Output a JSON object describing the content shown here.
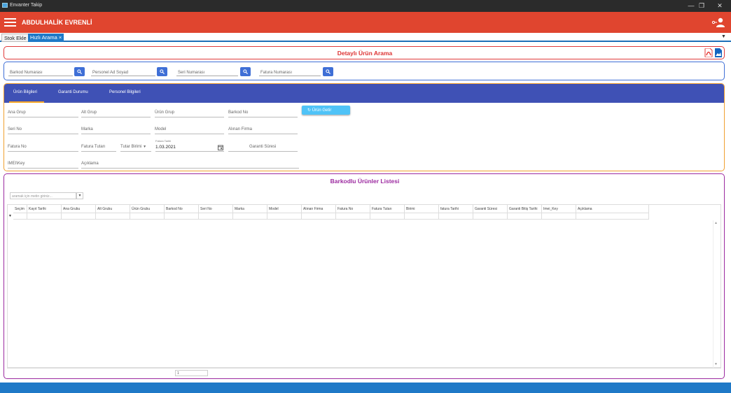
{
  "window": {
    "title": "Envanter Takip",
    "minimize": "—",
    "restore": "❐",
    "close": "✕"
  },
  "appbar": {
    "user_name": "ABDULHALİK EVRENLİ"
  },
  "doc_tabs": [
    {
      "label": "Stok Ekle"
    },
    {
      "label": "Hızlı Arama",
      "close": "×"
    }
  ],
  "tab_dropdown": "▼",
  "title_panel": {
    "title": "Detaylı Ürün Arama"
  },
  "search": {
    "barkod": "Barkod Numarası",
    "personel": "Personel Ad Soyad",
    "seri": "Seri Numarası",
    "fatura": "Fatura Numarası"
  },
  "detail": {
    "tabs": [
      "Ürün Bilgileri",
      "Garanti Durumu",
      "Personel Bilgileri"
    ],
    "fields": {
      "ana_grup": "Ana Grup",
      "alt_grup": "Alt Grup",
      "urun_grup": "Ürün Grup",
      "barkod_no": "Barkod No",
      "seri_no": "Seri No",
      "marka": "Marka",
      "model": "Model",
      "alinan_firma": "Alınan Firma",
      "fatura_no": "Fatura No",
      "fatura_tutari": "Fatura Tutarı",
      "tutar_birimi": "Tutar Birimi",
      "fatura_tarihi_label": "Fatura Tarihi",
      "fatura_tarihi": "1.03.2021",
      "garanti_suresi": "Garanti Süresi",
      "imei_key": "IMEI\\Key",
      "aciklama": "Açıklama"
    },
    "search_button": "Ürün Getir"
  },
  "list": {
    "title": "Barkodlu Ürünler Listesi",
    "search_placeholder": "aramak için metin giriniz...",
    "columns": [
      "Seçim",
      "Kayıt Tarihi",
      "Ana Grubu",
      "Alt Grubu",
      "Ürün Grubu",
      "Barkod No",
      "Seri No",
      "Marka",
      "Model",
      "Alınan Firma",
      "Fatura No",
      "Fatura Tutarı",
      "Birimi",
      "fatura Tarihi",
      "Garanti Süresi",
      "Garanti Bitiş Tarihi",
      "Imei_Key",
      "Açıklama"
    ],
    "page": "1"
  },
  "colors": {
    "appbar": "#e0452f",
    "tabbar": "#3f51b5",
    "accent": "#1f79c7"
  }
}
